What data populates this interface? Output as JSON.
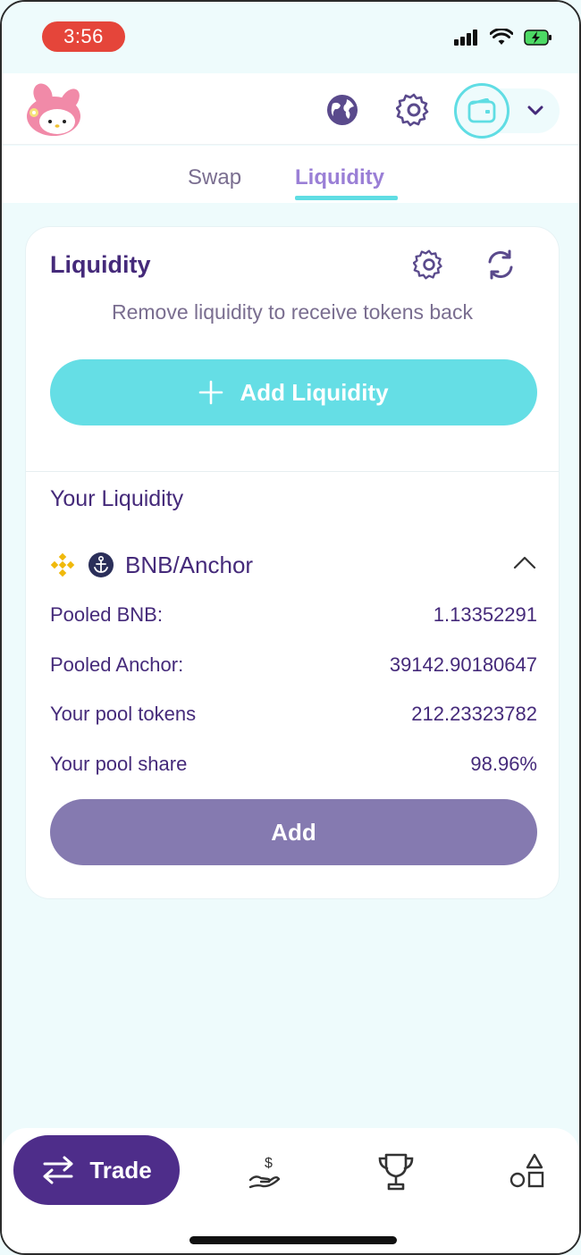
{
  "status_bar": {
    "time": "3:56",
    "icons": [
      "signal-icon",
      "wifi-icon",
      "battery-charging-icon"
    ]
  },
  "header": {
    "logo": "melody-logo",
    "icons": [
      "globe-icon",
      "gear-icon",
      "wallet-icon",
      "chevron-down-icon"
    ]
  },
  "tabs": {
    "swap_label": "Swap",
    "liquidity_label": "Liquidity",
    "active": "Liquidity"
  },
  "card": {
    "title": "Liquidity",
    "subtitle": "Remove liquidity to receive tokens back",
    "add_liquidity_label": "Add Liquidity",
    "your_liquidity_label": "Your Liquidity",
    "pair": {
      "name": "BNB/Anchor",
      "icons": [
        "bnb-icon",
        "anchor-icon"
      ]
    },
    "details": [
      {
        "label": "Pooled BNB:",
        "value": "1.13352291"
      },
      {
        "label": "Pooled Anchor:",
        "value": "39142.90180647"
      },
      {
        "label": "Your pool tokens",
        "value": "212.23323782"
      },
      {
        "label": "Your pool share",
        "value": "98.96%"
      }
    ],
    "add_label": "Add"
  },
  "bottom_nav": {
    "trade_label": "Trade",
    "items": [
      "trade-icon",
      "earn-icon",
      "trophy-icon",
      "shapes-icon"
    ]
  },
  "colors": {
    "background": "#eefbfc",
    "accent_cyan": "#65dee5",
    "primary_purple": "#452a7a",
    "trade_pill": "#4e2d8a",
    "add_button": "#857ab0",
    "time_pill": "#e5453a"
  }
}
